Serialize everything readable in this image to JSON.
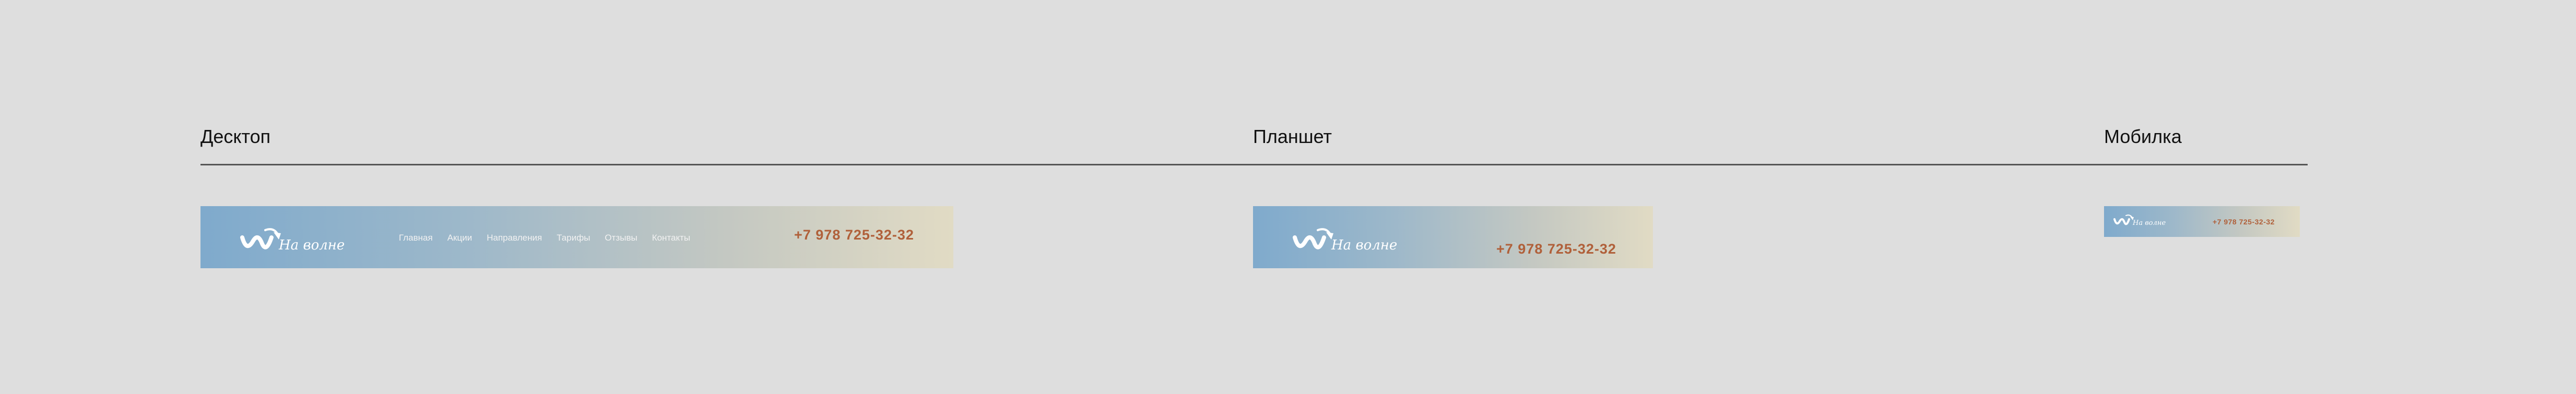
{
  "sections": {
    "desktop": {
      "title": "Десктоп"
    },
    "tablet": {
      "title": "Планшет"
    },
    "mobile": {
      "title": "Мобилка"
    }
  },
  "brand": {
    "logo_text": "На волне",
    "logo_icon": "wave-arrow-icon",
    "text_color": "#ffffff"
  },
  "nav": {
    "items": [
      "Главная",
      "Акции",
      "Направления",
      "Тарифы",
      "Отзывы",
      "Контакты"
    ]
  },
  "contact": {
    "phone": "+7 978 725-32-32",
    "phone_color": "#b0603a"
  },
  "colors": {
    "background": "#dedede",
    "gradient_start": "#7faacc",
    "gradient_end": "#e1dbc4"
  }
}
